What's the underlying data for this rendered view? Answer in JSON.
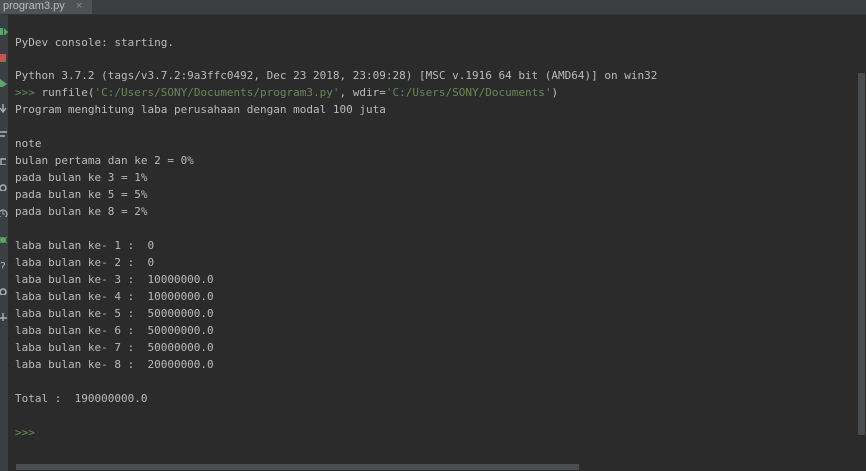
{
  "tab": {
    "title": "program3.py",
    "close": "×"
  },
  "toolbar": {
    "icons": [
      "rerun-icon",
      "stop-icon",
      "run-icon",
      "scroll-to-end-icon",
      "soft-wrap-icon",
      "loop-icon",
      "history-icon",
      "debug-icon",
      "help-icon",
      "settings-icon",
      "add-icon"
    ]
  },
  "console": {
    "lines": {
      "l1": "PyDev console: starting.",
      "l2": "Python 3.7.2 (tags/v3.7.2:9a3ffc0492, Dec 23 2018, 23:09:28) [MSC v.1916 64 bit (AMD64)] on win32",
      "l3_prompt": ">>> ",
      "l3_cmd": "runfile(",
      "l3_arg1": "'C:/Users/SONY/Documents/program3.py'",
      "l3_mid": ", wdir=",
      "l3_arg2": "'C:/Users/SONY/Documents'",
      "l3_end": ")",
      "l4": "Program menghitung laba perusahaan dengan modal 100 juta",
      "l5": "note",
      "l6": "bulan pertama dan ke 2 = 0%",
      "l7": "pada bulan ke 3 = 1%",
      "l8": "pada bulan ke 5 = 5%",
      "l9": "pada bulan ke 8 = 2%",
      "l10": "laba bulan ke- 1 :  0",
      "l11": "laba bulan ke- 2 :  0",
      "l12": "laba bulan ke- 3 :  10000000.0",
      "l13": "laba bulan ke- 4 :  10000000.0",
      "l14": "laba bulan ke- 5 :  50000000.0",
      "l15": "laba bulan ke- 6 :  50000000.0",
      "l16": "laba bulan ke- 7 :  50000000.0",
      "l17": "laba bulan ke- 8 :  20000000.0",
      "l18": "Total :  190000000.0",
      "l19_prompt": ">>>"
    }
  },
  "colors": {
    "background": "#2b2b2b",
    "text": "#bbbbbb",
    "prompt": "#6a8759"
  }
}
